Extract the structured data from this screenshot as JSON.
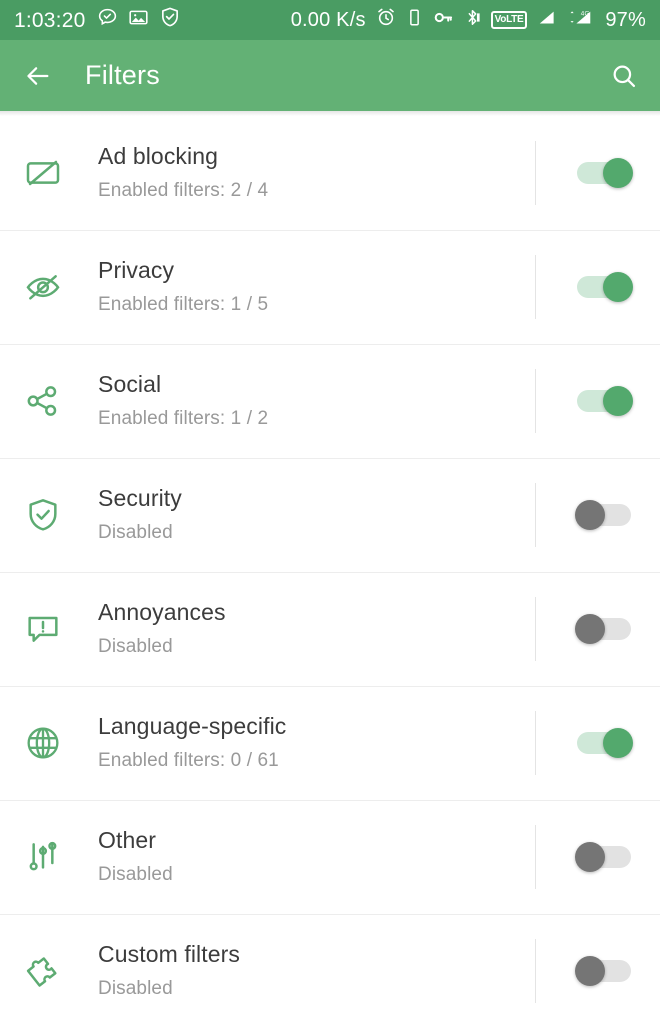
{
  "status_bar": {
    "clock": "1:03:20",
    "net_speed": "0.00 K/s",
    "battery": "97%",
    "volte_label": "VoLTE",
    "icons": [
      "chat-check-icon",
      "gallery-icon",
      "adguard-shield-icon",
      "alarm-icon",
      "vibrate-icon",
      "vpn-key-icon",
      "bluetooth-icon",
      "volte-badge",
      "signal-bars-icon",
      "signal-4g-icon"
    ],
    "background_color": "#4a9c63"
  },
  "app_bar": {
    "title": "Filters",
    "back_icon": "arrow-back-icon",
    "search_icon": "search-icon",
    "background_color": "#63b175"
  },
  "theme": {
    "accent": "#5dab72",
    "toggle_on_thumb": "#53a96d",
    "toggle_on_track": "#cfe8d8",
    "toggle_off_thumb": "#757575",
    "toggle_off_track": "#e2e2e2",
    "title_color": "#3c3c3c",
    "subtitle_color": "#999999"
  },
  "filters": [
    {
      "title": "Ad blocking",
      "subtitle": "Enabled filters: 2 / 4",
      "enabled": true,
      "icon": "ad-block-icon"
    },
    {
      "title": "Privacy",
      "subtitle": "Enabled filters: 1 / 5",
      "enabled": true,
      "icon": "eye-off-icon"
    },
    {
      "title": "Social",
      "subtitle": "Enabled filters: 1 / 2",
      "enabled": true,
      "icon": "share-icon"
    },
    {
      "title": "Security",
      "subtitle": "Disabled",
      "enabled": false,
      "icon": "shield-check-icon"
    },
    {
      "title": "Annoyances",
      "subtitle": "Disabled",
      "enabled": false,
      "icon": "alert-comment-icon"
    },
    {
      "title": "Language-specific",
      "subtitle": "Enabled filters: 0 / 61",
      "enabled": true,
      "icon": "globe-icon"
    },
    {
      "title": "Other",
      "subtitle": "Disabled",
      "enabled": false,
      "icon": "sliders-icon"
    },
    {
      "title": "Custom filters",
      "subtitle": "Disabled",
      "enabled": false,
      "icon": "puzzle-piece-icon"
    }
  ]
}
